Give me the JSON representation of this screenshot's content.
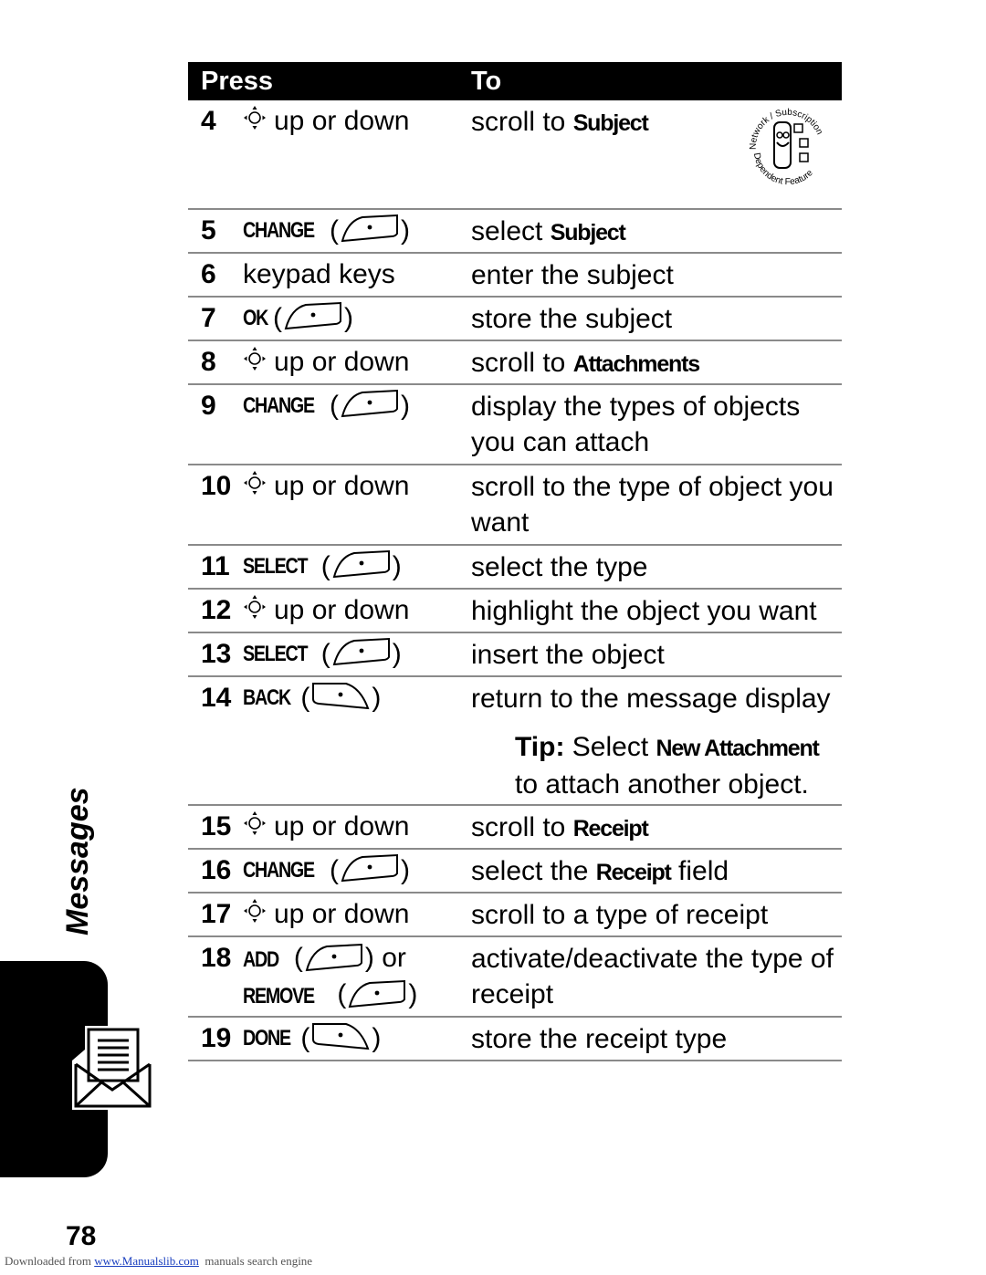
{
  "table": {
    "header": {
      "press": "Press",
      "to": "To"
    },
    "rows": [
      {
        "num": "4",
        "press_text": "up or down",
        "to_pre": "scroll to ",
        "to_kw": "Subject",
        "to_post": ""
      },
      {
        "num": "5",
        "key": "CHANGE",
        "to_pre": "select ",
        "to_kw": "Subject",
        "to_post": ""
      },
      {
        "num": "6",
        "press_text": "keypad keys",
        "to_pre": "enter the subject"
      },
      {
        "num": "7",
        "key": "OK",
        "to_pre": "store the subject"
      },
      {
        "num": "8",
        "press_text": "up or down",
        "to_pre": "scroll to ",
        "to_kw": "Attachments"
      },
      {
        "num": "9",
        "key": "CHANGE",
        "to_pre": "display the types of objects you can attach"
      },
      {
        "num": "10",
        "press_text": "up or down",
        "to_pre": "scroll to the type of object you want"
      },
      {
        "num": "11",
        "key": "SELECT",
        "to_pre": "select the type"
      },
      {
        "num": "12",
        "press_text": "up or down",
        "to_pre": "highlight the object you want"
      },
      {
        "num": "13",
        "key": "SELECT",
        "to_pre": "insert the object"
      },
      {
        "num": "14",
        "key": "BACK",
        "to_pre": "return to the message display",
        "tip_label": "Tip:",
        "tip_pre": " Select ",
        "tip_kw": "New Attachment",
        "tip_post": "to attach another object."
      },
      {
        "num": "15",
        "press_text": "up or down",
        "to_pre": "scroll to ",
        "to_kw": "Receipt"
      },
      {
        "num": "16",
        "key": "CHANGE",
        "to_pre": "select the ",
        "to_kw": "Receipt",
        "to_post": " field"
      },
      {
        "num": "17",
        "press_text": "up or down",
        "to_pre": "scroll to a type of receipt"
      },
      {
        "num": "18",
        "key": "ADD",
        "or": "or",
        "key2": "REMOVE",
        "to_pre": "activate/deactivate the type of receipt"
      },
      {
        "num": "19",
        "key": "DONE",
        "to_pre": "store the receipt type"
      }
    ]
  },
  "badge": {
    "top": "Network / Subscription",
    "bottom": "Dependent Feature"
  },
  "side": {
    "label": "Messages"
  },
  "page_number": "78",
  "footer": {
    "pre": "Downloaded from ",
    "link": "www.Manualslib.com",
    "post": "  manuals search engine"
  }
}
